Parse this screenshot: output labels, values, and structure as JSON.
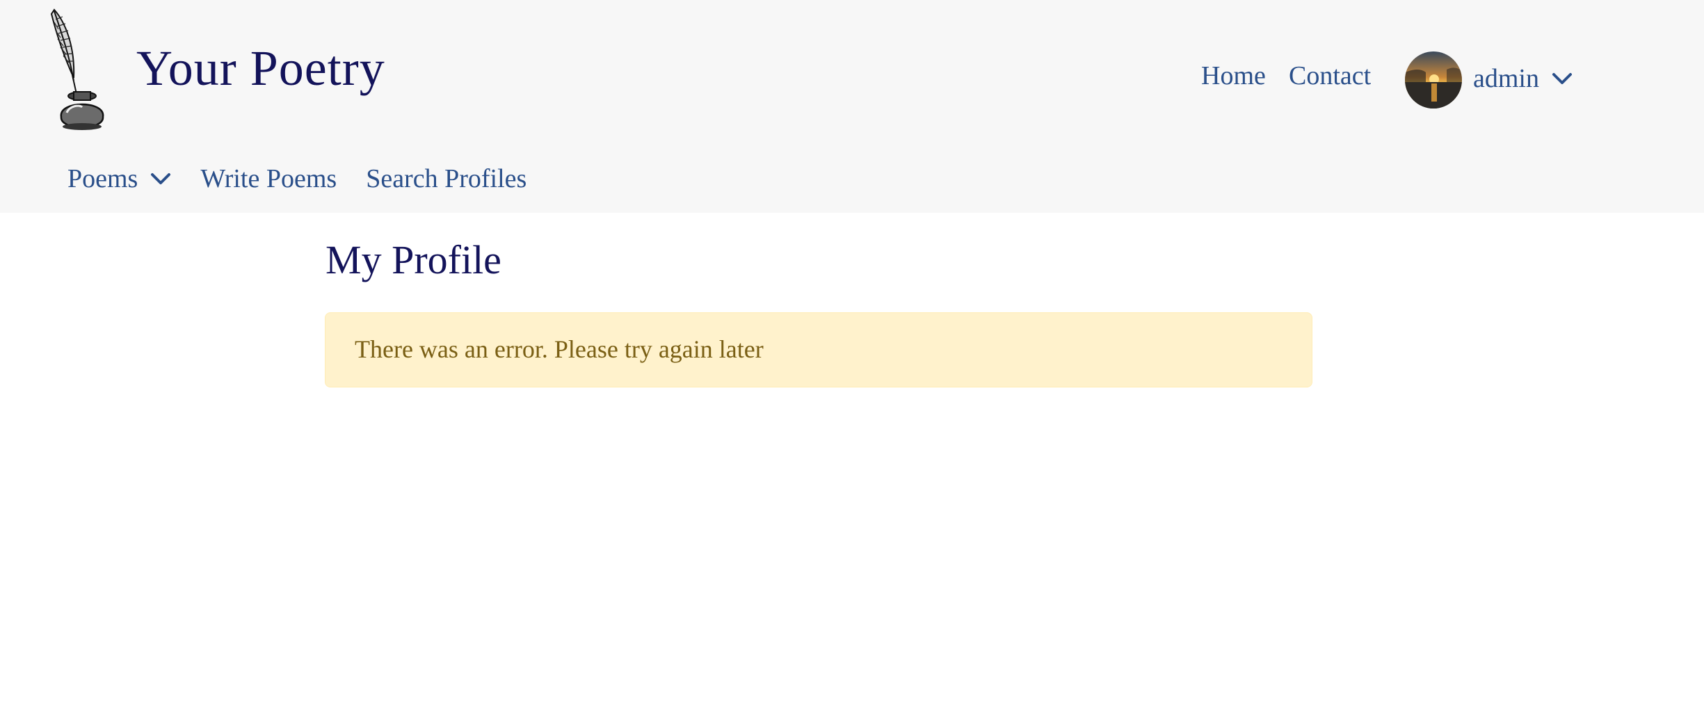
{
  "header": {
    "brand_title": "Your Poetry",
    "logo_icon": "quill-inkwell-icon"
  },
  "top_nav": {
    "home_label": "Home",
    "contact_label": "Contact"
  },
  "user": {
    "name": "admin",
    "avatar": "sunset-avatar-image",
    "menu_icon": "chevron-down-icon"
  },
  "sub_nav": {
    "items": [
      {
        "label": "Poems",
        "has_dropdown": true
      },
      {
        "label": "Write Poems",
        "has_dropdown": false
      },
      {
        "label": "Search Profiles",
        "has_dropdown": false
      }
    ]
  },
  "main": {
    "page_title": "My Profile",
    "alert": {
      "message": "There was an error. Please try again later",
      "type": "warning"
    }
  },
  "colors": {
    "header_bg": "#f7f7f7",
    "title": "#13135a",
    "link": "#2a4f8a",
    "alert_bg": "#fff2cc",
    "alert_text": "#7a5f14"
  }
}
